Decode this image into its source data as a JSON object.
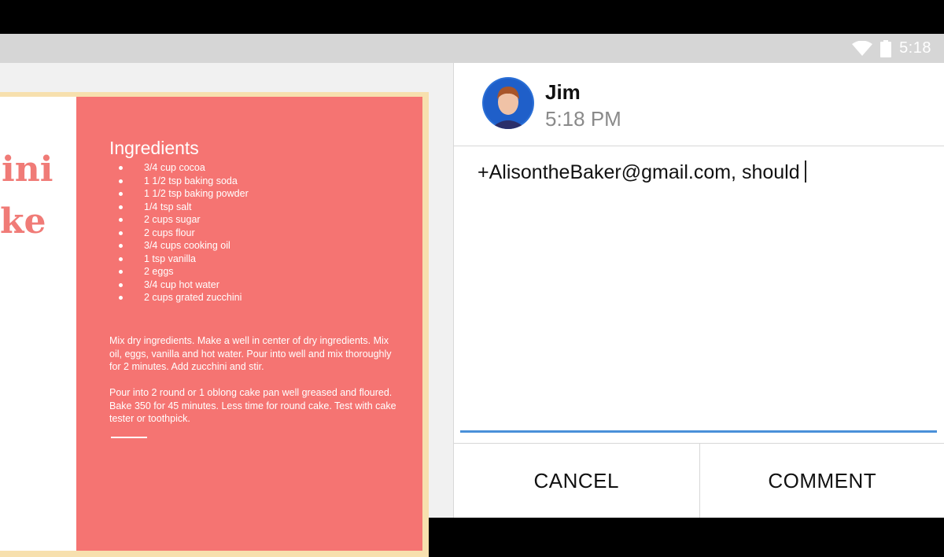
{
  "status_bar": {
    "time": "5:18",
    "icons": [
      "wifi-icon",
      "battery-icon"
    ]
  },
  "slide": {
    "title_lines": [
      "ini",
      "ke"
    ],
    "ingredients_heading": "Ingredients",
    "ingredients": [
      "3/4 cup cocoa",
      "1 1/2 tsp baking soda",
      "1 1/2 tsp baking powder",
      "1/4 tsp salt",
      "2 cups sugar",
      "2 cups flour",
      "3/4 cups cooking oil",
      "1 tsp vanilla",
      "2 eggs",
      "3/4 cup hot water",
      "2 cups grated zucchini"
    ],
    "instructions_1": "Mix dry ingredients. Make a well in center of dry ingredients. Mix oil, eggs, vanilla and hot water. Pour into well and mix thoroughly for 2 minutes. Add zucchini and stir.",
    "instructions_2": "Pour into 2 round or 1 oblong cake pan well greased and floured. Bake 350 for 45 minutes.  Less time for round cake. Test with cake tester or toothpick.",
    "colors": {
      "accent": "#f57472",
      "border": "#f7e0ae",
      "title": "#f07b77"
    }
  },
  "comment_dialog": {
    "user_name": "Jim",
    "time": "5:18 PM",
    "comment_text": "+AlisontheBaker@gmail.com, should",
    "cancel_label": "CANCEL",
    "comment_label": "COMMENT",
    "underline_color": "#4a90d9"
  }
}
